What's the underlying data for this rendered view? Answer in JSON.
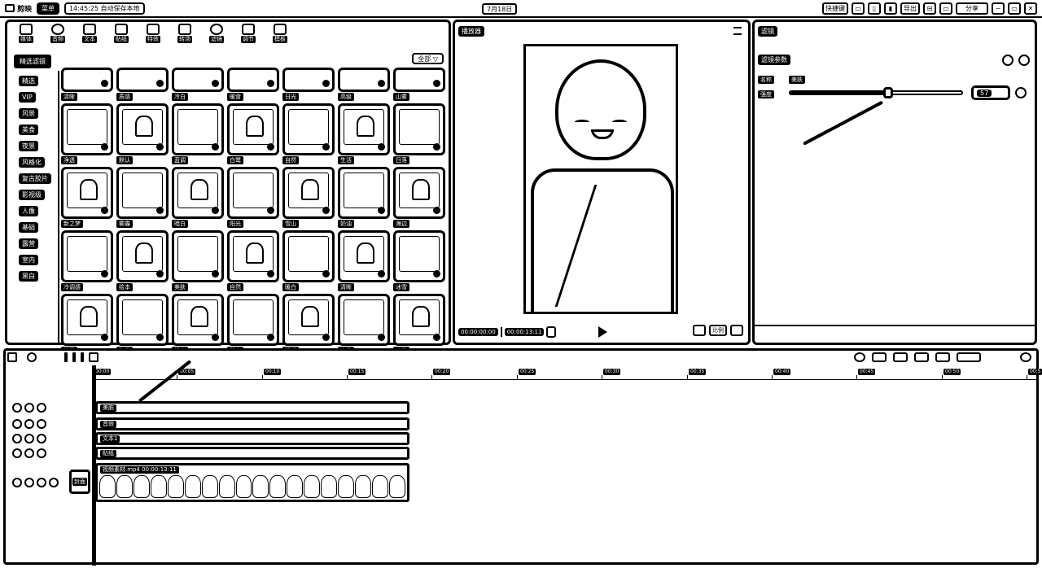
{
  "titlebar": {
    "app_name": "剪映",
    "menu_label": "菜单",
    "autosave": "14:45:25 自动保存本地",
    "date_center": "7月18日",
    "right_buttons": [
      "快捷键",
      "▭",
      "▯",
      "▮",
      "导出",
      "⊟",
      "▭",
      "分享"
    ],
    "window": [
      "─",
      "▭",
      "✕"
    ]
  },
  "media": {
    "tabs": [
      "媒体",
      "音频",
      "文本",
      "贴纸",
      "特效",
      "转场",
      "滤镜",
      "调节",
      "模板"
    ],
    "category_selected": "精选滤镜",
    "categories": [
      "精选",
      "VIP",
      "风景",
      "美食",
      "夜景",
      "风格化",
      "复古胶片",
      "影视级",
      "人像",
      "基础",
      "露营",
      "室内",
      "黑白"
    ],
    "filter_button": "全部 ▽",
    "rows": [
      {
        "short": true,
        "items": [
          "清晰",
          "质感",
          "冷白",
          "暖食",
          "日光",
          "高级",
          "山雾"
        ]
      },
      {
        "short": false,
        "items": [
          "净透",
          "默认",
          "蓝调",
          "白鹭",
          "自然",
          "生活",
          "日落"
        ]
      },
      {
        "short": false,
        "items": [
          "新之梦",
          "雾霾",
          "暗白",
          "阳光",
          "雪山",
          "奶油",
          "海边"
        ]
      },
      {
        "short": false,
        "items": [
          "冷调感",
          "绘本",
          "美肤",
          "自然",
          "暖白",
          "清晰",
          "冰雪"
        ]
      },
      {
        "short": false,
        "items": [
          "港风",
          "海景",
          "奶白",
          "复古",
          "清透",
          "白净",
          "淡雅"
        ]
      }
    ]
  },
  "player": {
    "title": "播放器",
    "current_time": "00:00:00:00",
    "total_time": "00:00:13:11",
    "ratio_label": "比例",
    "buttons": [
      "截图",
      "比例",
      "全屏"
    ]
  },
  "properties": {
    "title": "滤镜",
    "subtitle": "滤镜参数",
    "name_label": "名称",
    "name_value": "美肤",
    "intensity_label": "强度",
    "intensity_value": "57",
    "intensity_fraction": 0.57
  },
  "timeline": {
    "ruler_ticks": [
      "00:00",
      "00:05",
      "00:10",
      "00:15",
      "00:20",
      "00:25",
      "00:30",
      "00:35",
      "00:40",
      "00:45",
      "00:50",
      "00:5"
    ],
    "tracks": [
      {
        "label": "美肤"
      },
      {
        "label": "音效"
      },
      {
        "label": "文本1"
      },
      {
        "label": "贴纸"
      }
    ],
    "video_clip_label": "视频素材.mp4 00:00:13:11",
    "cover_label": "封面"
  }
}
